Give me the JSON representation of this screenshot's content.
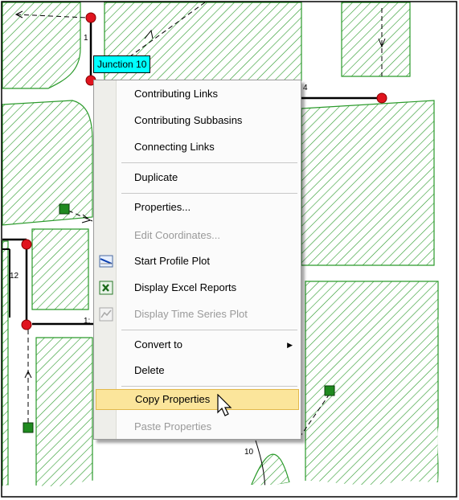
{
  "map": {
    "junction_label": "Junction 10",
    "link_numbers": [
      "1",
      "4",
      "12",
      "1:",
      "10"
    ]
  },
  "context_menu": {
    "items": [
      {
        "label": "Contributing Links",
        "enabled": true
      },
      {
        "label": "Contributing Subbasins",
        "enabled": true
      },
      {
        "label": "Connecting Links",
        "enabled": true
      },
      {
        "label": "Duplicate",
        "enabled": true
      },
      {
        "label": "Properties...",
        "enabled": true
      },
      {
        "label": "Edit Coordinates...",
        "enabled": false
      },
      {
        "label": "Start Profile Plot",
        "enabled": true,
        "icon": "profile-plot-icon"
      },
      {
        "label": "Display Excel Reports",
        "enabled": true,
        "icon": "excel-icon"
      },
      {
        "label": "Display Time Series Plot",
        "enabled": false,
        "icon": "time-series-icon"
      },
      {
        "label": "Convert to",
        "enabled": true,
        "submenu": true
      },
      {
        "label": "Delete",
        "enabled": true
      },
      {
        "label": "Copy Properties",
        "enabled": true,
        "highlighted": true
      },
      {
        "label": "Paste Properties",
        "enabled": false
      }
    ],
    "highlight_color": "#fbe59b"
  },
  "colors": {
    "hatch": "#2a9a2a",
    "node": "#e0141e",
    "label_bg": "#00ffff"
  }
}
